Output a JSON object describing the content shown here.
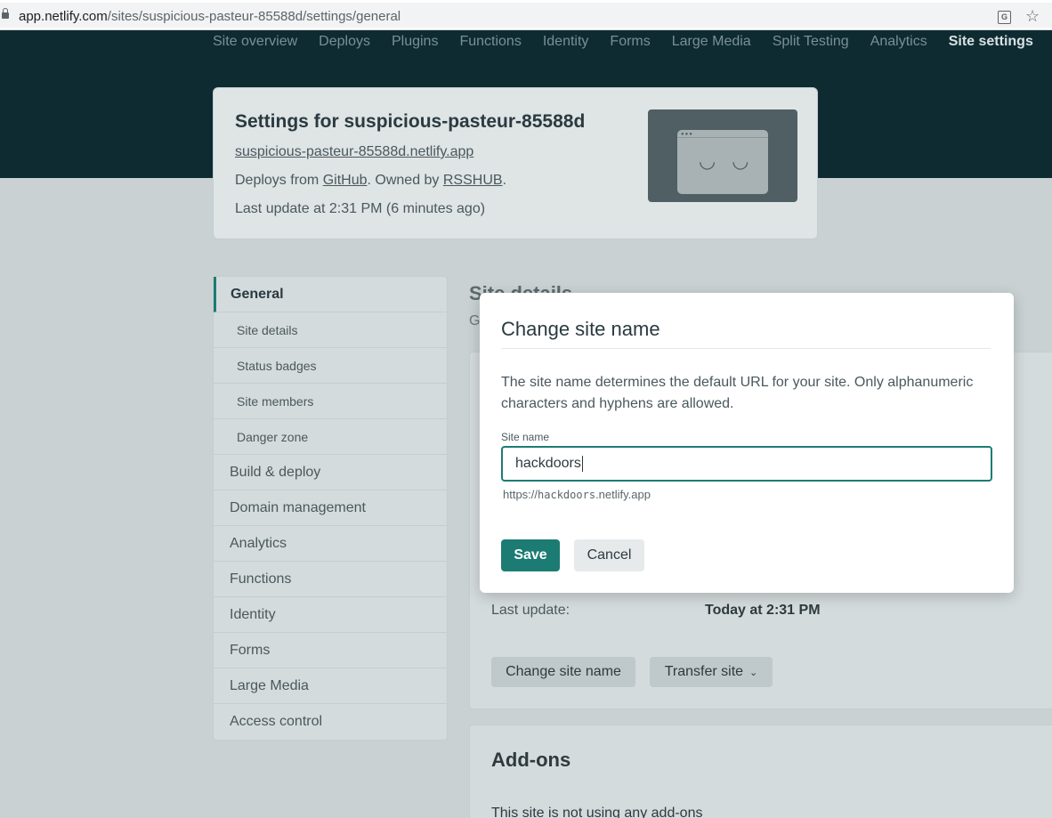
{
  "browser": {
    "url_host": "app.netlify.com",
    "url_path": "/sites/suspicious-pasteur-85588d/settings/general"
  },
  "topnav": {
    "items": [
      "Site overview",
      "Deploys",
      "Plugins",
      "Functions",
      "Identity",
      "Forms",
      "Large Media",
      "Split Testing",
      "Analytics",
      "Site settings"
    ],
    "active_index": 9
  },
  "site_card": {
    "title": "Settings for suspicious-pasteur-85588d",
    "site_url": "suspicious-pasteur-85588d.netlify.app",
    "deploys_prefix": "Deploys from ",
    "deploys_source": "GitHub",
    "owned_prefix": ". Owned by ",
    "owner": "RSSHUB",
    "owned_suffix": ".",
    "last_update": "Last update at 2:31 PM (6 minutes ago)"
  },
  "sidebar": {
    "items": [
      {
        "label": "General",
        "type": "section",
        "active": true
      },
      {
        "label": "Site details",
        "type": "sub"
      },
      {
        "label": "Status badges",
        "type": "sub"
      },
      {
        "label": "Site members",
        "type": "sub"
      },
      {
        "label": "Danger zone",
        "type": "sub"
      },
      {
        "label": "Build & deploy",
        "type": "section"
      },
      {
        "label": "Domain management",
        "type": "section"
      },
      {
        "label": "Analytics",
        "type": "section"
      },
      {
        "label": "Functions",
        "type": "section"
      },
      {
        "label": "Identity",
        "type": "section"
      },
      {
        "label": "Forms",
        "type": "section"
      },
      {
        "label": "Large Media",
        "type": "section"
      },
      {
        "label": "Access control",
        "type": "section"
      }
    ]
  },
  "main": {
    "title": "Site details",
    "subtitle_start": "G",
    "last_update_label": "Last update:",
    "last_update_value": "Today at 2:31 PM",
    "change_site_name_label": "Change site name",
    "transfer_site_label": "Transfer site",
    "addons_title": "Add-ons",
    "addons_text": "This site is not using any add-ons"
  },
  "modal": {
    "title": "Change site name",
    "description": "The site name determines the default URL for your site. Only alphanumeric characters and hyphens are allowed.",
    "field_label": "Site name",
    "field_value": "hackdoors",
    "preview_prefix": "https://",
    "preview_name": "hackdoors",
    "preview_suffix": ".netlify.app",
    "save_label": "Save",
    "cancel_label": "Cancel"
  },
  "colors": {
    "header_bg": "#0e2b32",
    "accent": "#1c7c74",
    "overlay_bg": "#c9d1d3"
  }
}
